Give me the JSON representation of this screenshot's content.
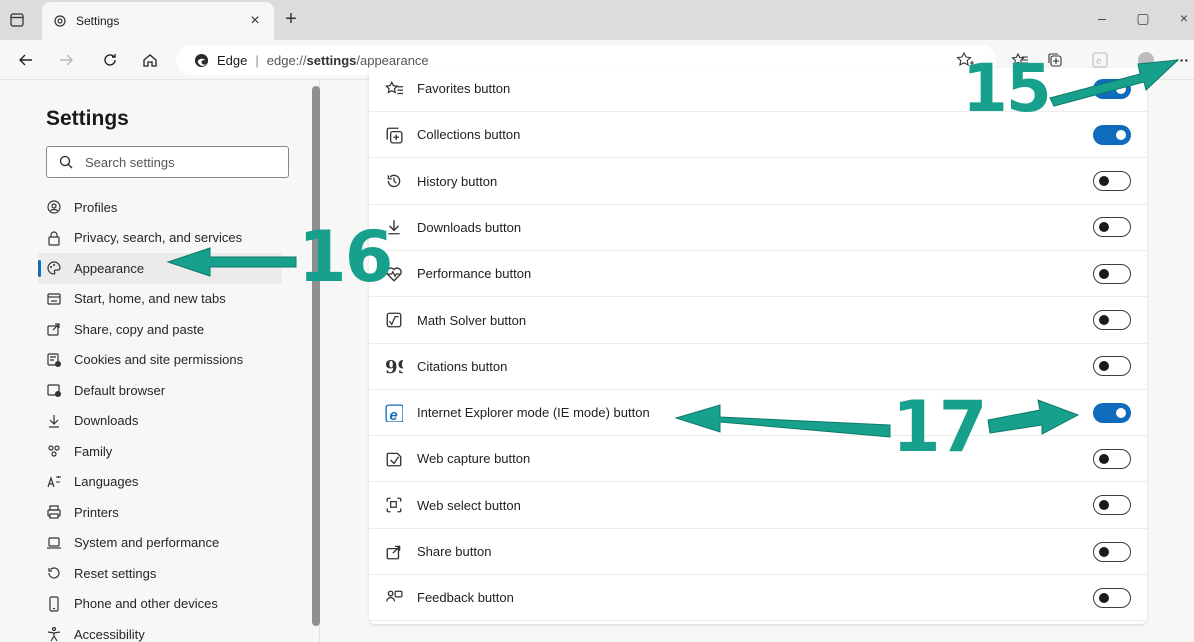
{
  "tab": {
    "title": "Settings",
    "close": "×",
    "newtab": "+"
  },
  "window": {
    "minimize": "–",
    "restore": "▢",
    "close": "×"
  },
  "address": {
    "browser_label": "Edge",
    "separator": "|",
    "url_scheme": "edge://",
    "url_host": "settings",
    "url_path": "/appearance",
    "more": "···"
  },
  "sidebar": {
    "title": "Settings",
    "search_placeholder": "Search settings",
    "items": [
      {
        "label": "Profiles",
        "icon": "profile-icon"
      },
      {
        "label": "Privacy, search, and services",
        "icon": "lock-icon"
      },
      {
        "label": "Appearance",
        "icon": "palette-icon",
        "active": true
      },
      {
        "label": "Start, home, and new tabs",
        "icon": "home-tab-icon"
      },
      {
        "label": "Share, copy and paste",
        "icon": "share-icon"
      },
      {
        "label": "Cookies and site permissions",
        "icon": "cookie-icon"
      },
      {
        "label": "Default browser",
        "icon": "browser-icon"
      },
      {
        "label": "Downloads",
        "icon": "download-icon"
      },
      {
        "label": "Family",
        "icon": "family-icon"
      },
      {
        "label": "Languages",
        "icon": "language-icon"
      },
      {
        "label": "Printers",
        "icon": "printer-icon"
      },
      {
        "label": "System and performance",
        "icon": "laptop-icon"
      },
      {
        "label": "Reset settings",
        "icon": "reset-icon"
      },
      {
        "label": "Phone and other devices",
        "icon": "phone-icon"
      },
      {
        "label": "Accessibility",
        "icon": "accessibility-icon"
      }
    ]
  },
  "buttons": [
    {
      "label": "Favorites button",
      "icon": "favorites-icon",
      "on": true
    },
    {
      "label": "Collections button",
      "icon": "collections-icon",
      "on": true
    },
    {
      "label": "History button",
      "icon": "history-icon",
      "on": false
    },
    {
      "label": "Downloads button",
      "icon": "download-icon",
      "on": false
    },
    {
      "label": "Performance button",
      "icon": "performance-icon",
      "on": false
    },
    {
      "label": "Math Solver button",
      "icon": "math-solver-icon",
      "on": false
    },
    {
      "label": "Citations button",
      "icon": "citations-icon",
      "on": false
    },
    {
      "label": "Internet Explorer mode (IE mode) button",
      "icon": "ie-icon",
      "on": true
    },
    {
      "label": "Web capture button",
      "icon": "web-capture-icon",
      "on": false
    },
    {
      "label": "Web select button",
      "icon": "web-select-icon",
      "on": false
    },
    {
      "label": "Share button",
      "icon": "share-icon",
      "on": false
    },
    {
      "label": "Feedback button",
      "icon": "feedback-icon",
      "on": false
    }
  ],
  "annotations": {
    "a15": "15",
    "a16": "16",
    "a17": "17"
  },
  "colors": {
    "accent": "#0f6cbd",
    "annotation": "#17a08b"
  }
}
